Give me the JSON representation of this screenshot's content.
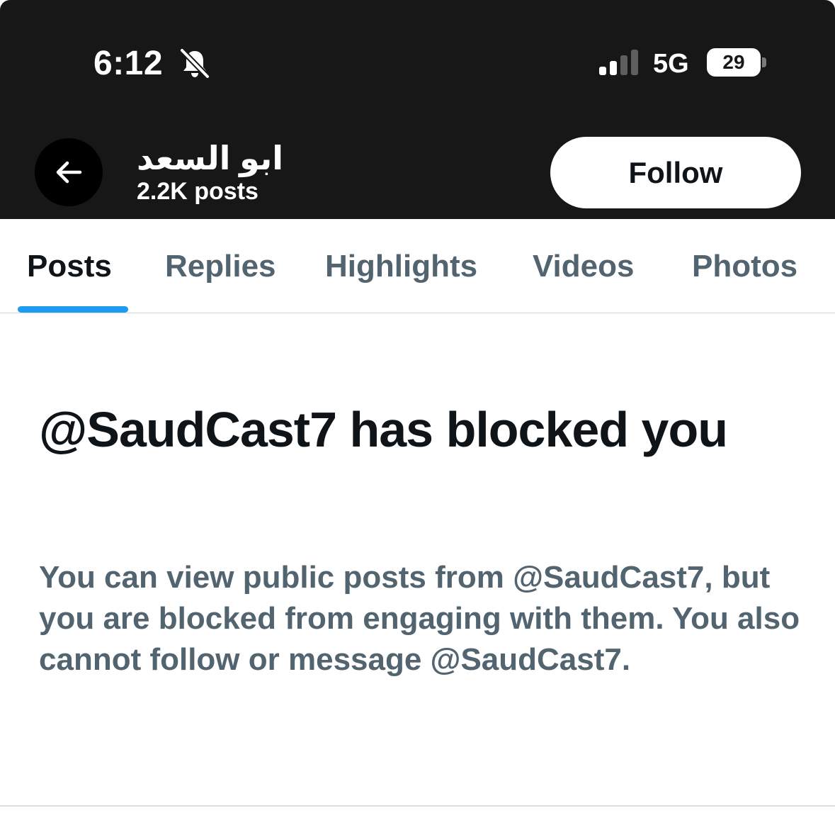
{
  "status_bar": {
    "time": "6:12",
    "network": "5G",
    "battery": "29",
    "icons": [
      "bell-off-icon",
      "signal-bars-icon",
      "battery-icon"
    ]
  },
  "header": {
    "back_icon": "arrow-left-icon",
    "name": "ابو السعد",
    "post_count": "2.2K posts",
    "follow_label": "Follow"
  },
  "tabs": [
    {
      "label": "Posts",
      "active": true
    },
    {
      "label": "Replies",
      "active": false
    },
    {
      "label": "Highlights",
      "active": false
    },
    {
      "label": "Videos",
      "active": false
    },
    {
      "label": "Photos",
      "active": false
    }
  ],
  "blocked": {
    "title": "@SaudCast7 has blocked you",
    "description": "You can view public posts from @SaudCast7, but you are blocked from engaging with them. You also cannot follow or message @SaudCast7."
  },
  "colors": {
    "header_bg": "#171717",
    "accent": "#1d9bf0",
    "primary_text": "#0f1419",
    "secondary_text": "#536471"
  }
}
